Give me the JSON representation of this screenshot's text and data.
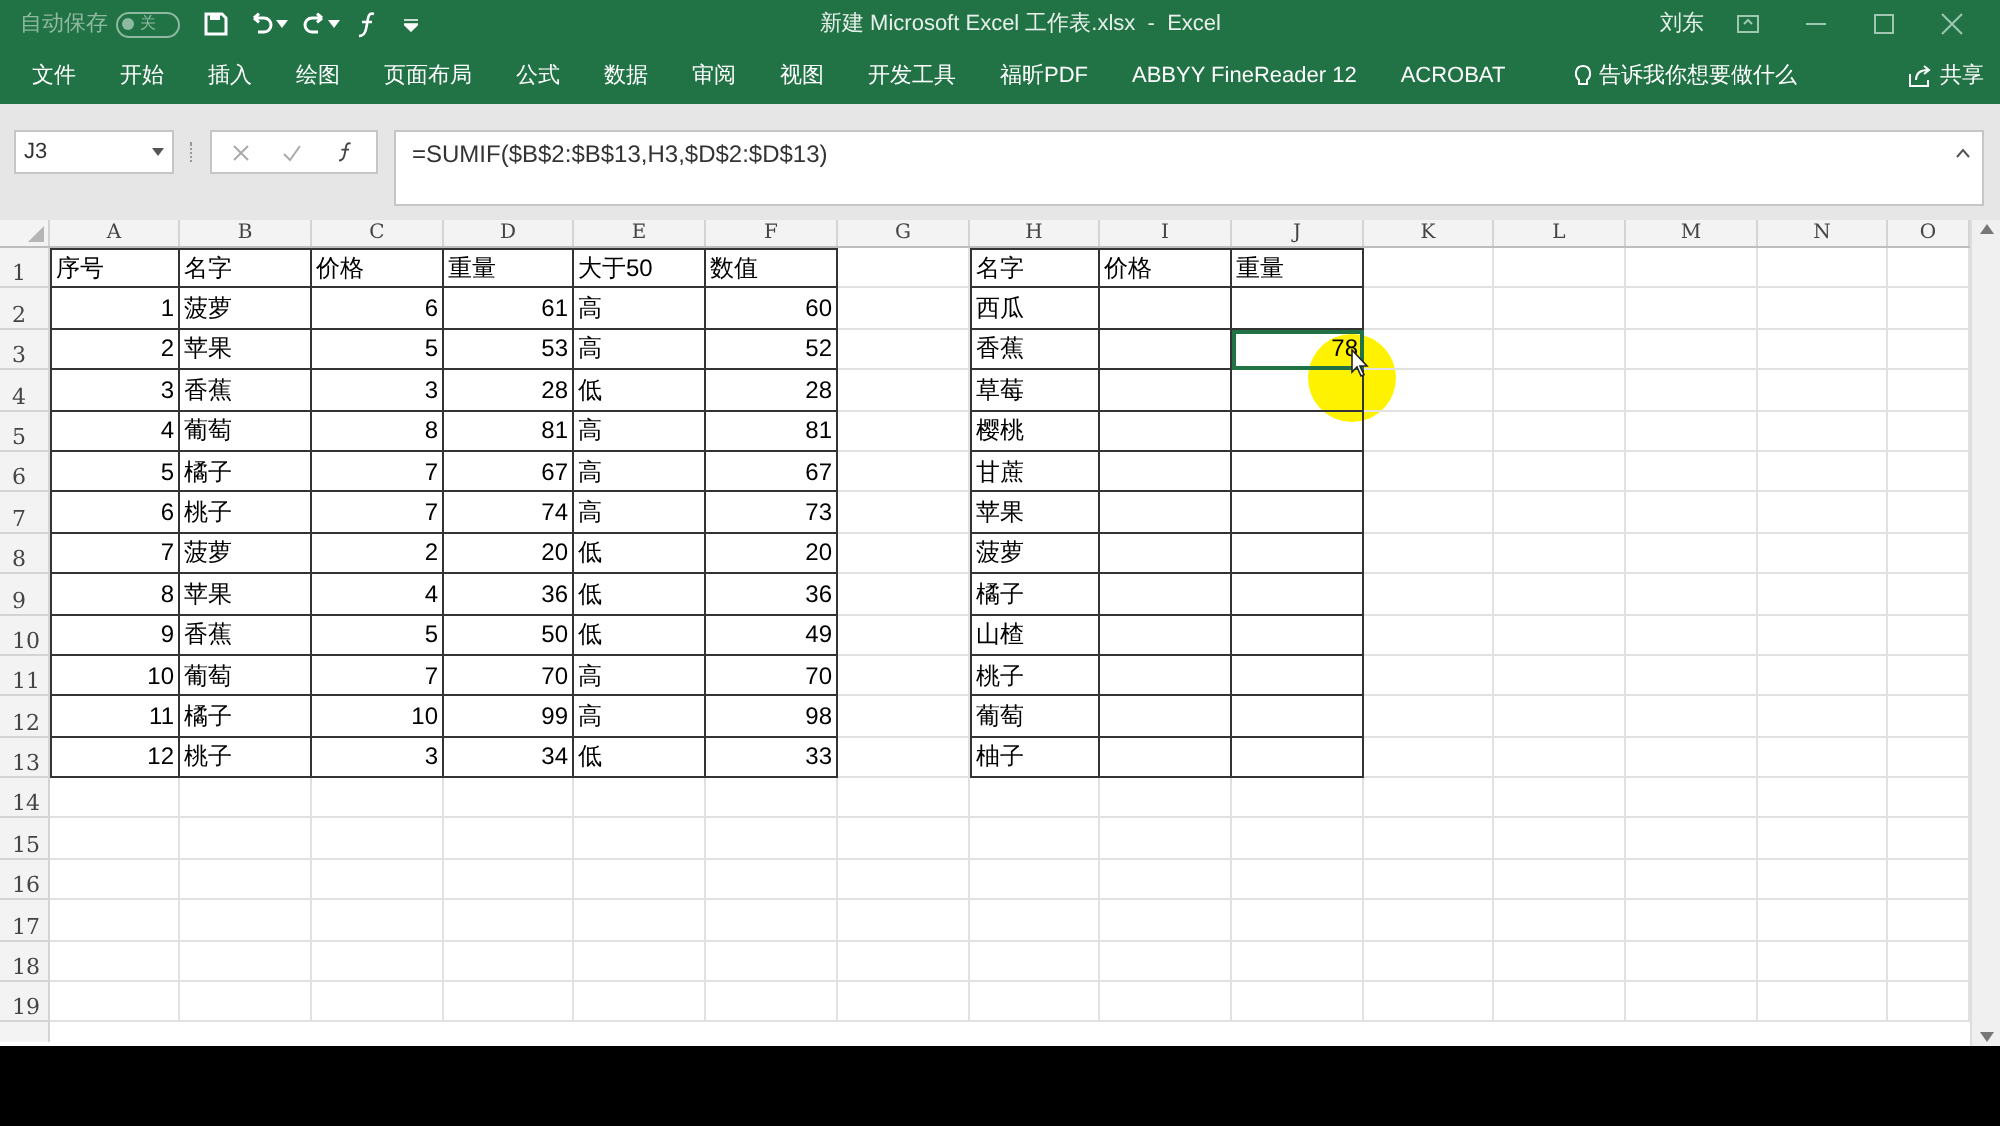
{
  "title_bar": {
    "autosave_label": "自动保存",
    "autosave": {
      "on": false,
      "label": "关"
    },
    "title": "新建 Microsoft Excel 工作表.xlsx  -  Excel",
    "user": "刘东"
  },
  "ribbon_tabs": [
    "文件",
    "开始",
    "插入",
    "绘图",
    "页面布局",
    "公式",
    "数据",
    "审阅",
    "视图",
    "开发工具",
    "福昕PDF",
    "ABBYY FineReader 12",
    "ACROBAT"
  ],
  "tell_me": "告诉我你想要做什么",
  "share": "共享",
  "formula_bar": {
    "name_box": "J3",
    "formula": "=SUMIF($B$2:$B$13,H3,$D$2:$D$13)"
  },
  "column_headers": [
    "A",
    "B",
    "C",
    "D",
    "E",
    "F",
    "G",
    "H",
    "I",
    "J",
    "K",
    "L",
    "M",
    "N",
    "O"
  ],
  "row_numbers": [
    "1",
    "2",
    "3",
    "4",
    "5",
    "6",
    "7",
    "8",
    "9",
    "10",
    "11",
    "12",
    "13",
    "14",
    "15",
    "16",
    "17",
    "18",
    "19"
  ],
  "table1": {
    "columns": [
      {
        "label": "序号",
        "numeric": true
      },
      {
        "label": "名字",
        "numeric": false
      },
      {
        "label": "价格",
        "numeric": true
      },
      {
        "label": "重量",
        "numeric": true
      },
      {
        "label": "大于50",
        "numeric": false
      },
      {
        "label": "数值",
        "numeric": true
      }
    ],
    "rows": [
      [
        "1",
        "菠萝",
        "6",
        "61",
        "高",
        "60"
      ],
      [
        "2",
        "苹果",
        "5",
        "53",
        "高",
        "52"
      ],
      [
        "3",
        "香蕉",
        "3",
        "28",
        "低",
        "28"
      ],
      [
        "4",
        "葡萄",
        "8",
        "81",
        "高",
        "81"
      ],
      [
        "5",
        "橘子",
        "7",
        "67",
        "高",
        "67"
      ],
      [
        "6",
        "桃子",
        "7",
        "74",
        "高",
        "73"
      ],
      [
        "7",
        "菠萝",
        "2",
        "20",
        "低",
        "20"
      ],
      [
        "8",
        "苹果",
        "4",
        "36",
        "低",
        "36"
      ],
      [
        "9",
        "香蕉",
        "5",
        "50",
        "低",
        "49"
      ],
      [
        "10",
        "葡萄",
        "7",
        "70",
        "高",
        "70"
      ],
      [
        "11",
        "橘子",
        "10",
        "99",
        "高",
        "98"
      ],
      [
        "12",
        "桃子",
        "3",
        "34",
        "低",
        "33"
      ]
    ]
  },
  "table2": {
    "columns": [
      "名字",
      "价格",
      "重量"
    ],
    "rows": [
      {
        "name": "西瓜",
        "selected": false
      },
      {
        "name": "香蕉",
        "weight": "78",
        "selected": true
      },
      {
        "name": "草莓",
        "selected": false
      },
      {
        "name": "樱桃",
        "selected": false
      },
      {
        "name": "甘蔗",
        "selected": false
      },
      {
        "name": "苹果",
        "selected": false
      },
      {
        "name": "菠萝",
        "selected": false
      },
      {
        "name": "橘子",
        "selected": false
      },
      {
        "name": "山楂",
        "selected": false
      },
      {
        "name": "桃子",
        "selected": false
      },
      {
        "name": "葡萄",
        "selected": false
      },
      {
        "name": "柚子",
        "selected": false
      }
    ]
  }
}
